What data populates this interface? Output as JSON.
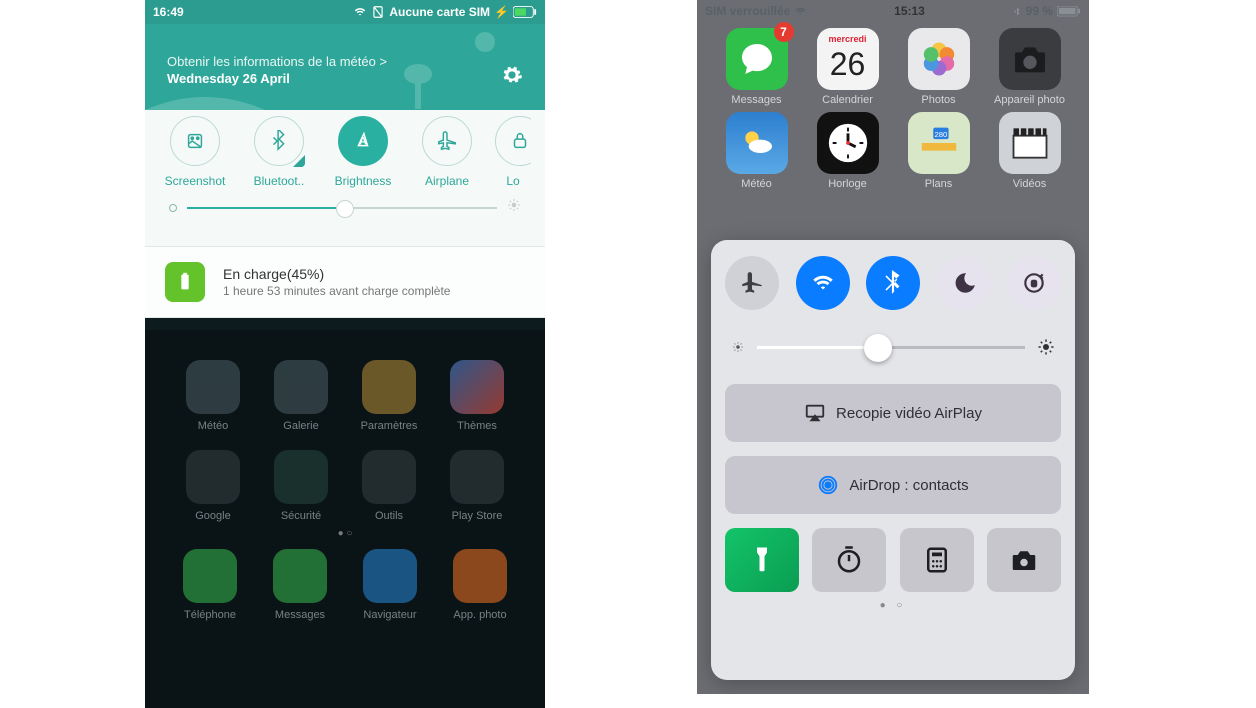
{
  "android": {
    "status": {
      "time": "16:49",
      "sim_text": "Aucune carte SIM"
    },
    "banner": {
      "line1": "Obtenir les informations de la météo >",
      "line2": "Wednesday 26 April"
    },
    "tiles": [
      {
        "name": "screenshot",
        "label": "Screenshot",
        "on": false
      },
      {
        "name": "bluetooth",
        "label": "Bluetoot..",
        "on": false,
        "corner": true
      },
      {
        "name": "brightness",
        "label": "Brightness",
        "on": true
      },
      {
        "name": "airplane",
        "label": "Airplane",
        "on": false
      },
      {
        "name": "lock",
        "label": "Lo",
        "on": false
      }
    ],
    "battery": {
      "title": "En charge(45%)",
      "sub": "1 heure 53 minutes  avant charge complète"
    },
    "home_apps": [
      {
        "label": "Météo",
        "bg": "#3a4a50"
      },
      {
        "label": "Galerie",
        "bg": "#3a4a50"
      },
      {
        "label": "Paramètres",
        "bg": "#8b6f30"
      },
      {
        "label": "Thèmes",
        "bg": "linear-gradient(135deg,#3b6cb0,#c6473a)"
      },
      {
        "label": "Google",
        "bg": "#2b3438"
      },
      {
        "label": "Sécurité",
        "bg": "#1f3a34"
      },
      {
        "label": "Outils",
        "bg": "#2b3438"
      },
      {
        "label": "Play Store",
        "bg": "#2b3438"
      }
    ],
    "dock": [
      {
        "label": "Téléphone",
        "bg": "#2a8f3f"
      },
      {
        "label": "Messages",
        "bg": "#2a8f3f"
      },
      {
        "label": "Navigateur",
        "bg": "#1e6aa8"
      },
      {
        "label": "App. photo",
        "bg": "#b85a1f"
      }
    ]
  },
  "ios": {
    "status": {
      "left": "SIM verrouillée",
      "time": "15:13",
      "right": "99 %"
    },
    "home_apps": [
      {
        "label": "Messages",
        "bg": "#2fbf4b",
        "badge": "7"
      },
      {
        "label": "Calendrier",
        "bg": "#f4f4f4",
        "cal_day": "mercredi",
        "cal_num": "26"
      },
      {
        "label": "Photos",
        "bg": "#e9e9ec"
      },
      {
        "label": "Appareil photo",
        "bg": "#3a3c40"
      },
      {
        "label": "Météo",
        "bg": "linear-gradient(#2d7fcf,#5aa9e6)"
      },
      {
        "label": "Horloge",
        "bg": "#111"
      },
      {
        "label": "Plans",
        "bg": "#d8e7c7"
      },
      {
        "label": "Vidéos",
        "bg": "#cfd2d7"
      }
    ],
    "cc": {
      "airplay": "Recopie vidéo AirPlay",
      "airdrop": "AirDrop : contacts"
    }
  }
}
